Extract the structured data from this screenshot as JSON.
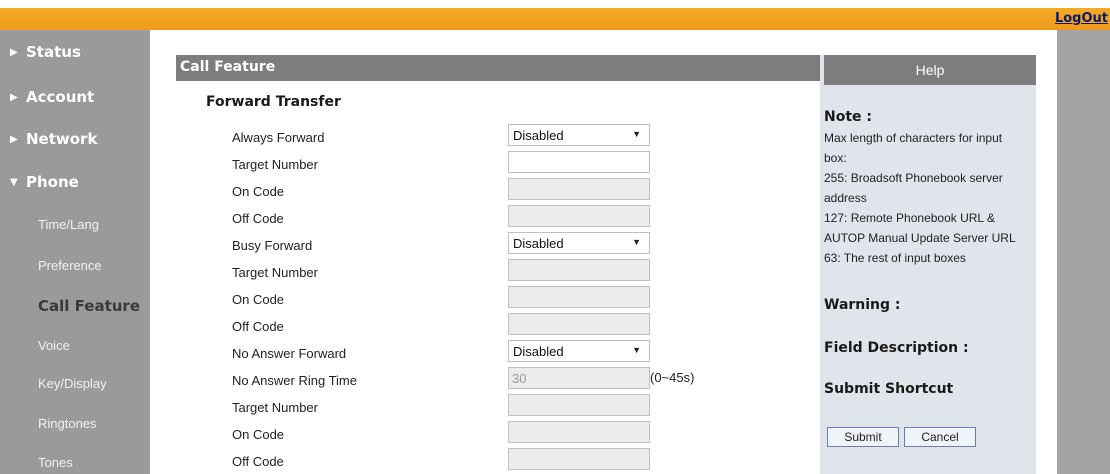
{
  "header": {
    "logout_label": "LogOut"
  },
  "sidebar": {
    "top_items": [
      {
        "label": "Status"
      },
      {
        "label": "Account"
      },
      {
        "label": "Network"
      },
      {
        "label": "Phone"
      }
    ],
    "expand_glyph": "▶",
    "open_glyph": "▼",
    "sub_items": [
      {
        "label": "Time/Lang"
      },
      {
        "label": "Preference"
      },
      {
        "label": "Call Feature"
      },
      {
        "label": "Voice"
      },
      {
        "label": "Key/Display"
      },
      {
        "label": "Ringtones"
      },
      {
        "label": "Tones"
      }
    ],
    "active_item": "Call Feature"
  },
  "main": {
    "panel_title": "Call Feature",
    "section_title": "Forward Transfer",
    "always_forward": {
      "label": "Always Forward",
      "value": "Disabled"
    },
    "always_target": {
      "label": "Target Number",
      "value": ""
    },
    "always_on_code": {
      "label": "On Code",
      "value": ""
    },
    "always_off_code": {
      "label": "Off Code",
      "value": ""
    },
    "busy_forward": {
      "label": "Busy Forward",
      "value": "Disabled"
    },
    "busy_target": {
      "label": "Target Number",
      "value": ""
    },
    "busy_on_code": {
      "label": "On Code",
      "value": ""
    },
    "busy_off_code": {
      "label": "Off Code",
      "value": ""
    },
    "no_answer_forward": {
      "label": "No Answer Forward",
      "value": "Disabled"
    },
    "ring_time": {
      "label": "No Answer Ring Time",
      "value": "30",
      "unit": "(0~45s)"
    },
    "no_answer_target": {
      "label": "Target Number",
      "value": ""
    },
    "no_answer_on_code": {
      "label": "On Code",
      "value": ""
    },
    "no_answer_off_code": {
      "label": "Off Code",
      "value": ""
    }
  },
  "help": {
    "title": "Help",
    "note_heading": "Note :",
    "note_lines": [
      "Max length of characters for input",
      "box:",
      "255: Broadsoft Phonebook server",
      "address",
      "127: Remote Phonebook URL &",
      "AUTOP Manual Update Server URL",
      "63: The rest of input boxes"
    ],
    "warning_heading": "Warning :",
    "field_description_heading": "Field Description :",
    "submit_shortcut_heading": "Submit Shortcut",
    "submit_label": "Submit",
    "cancel_label": "Cancel"
  },
  "colors": {
    "top_bar": "#f09a1c",
    "sidebar_bg": "#9a9a9a",
    "panel_header": "#7d7d7d",
    "help_bg": "#dfe5eb"
  }
}
